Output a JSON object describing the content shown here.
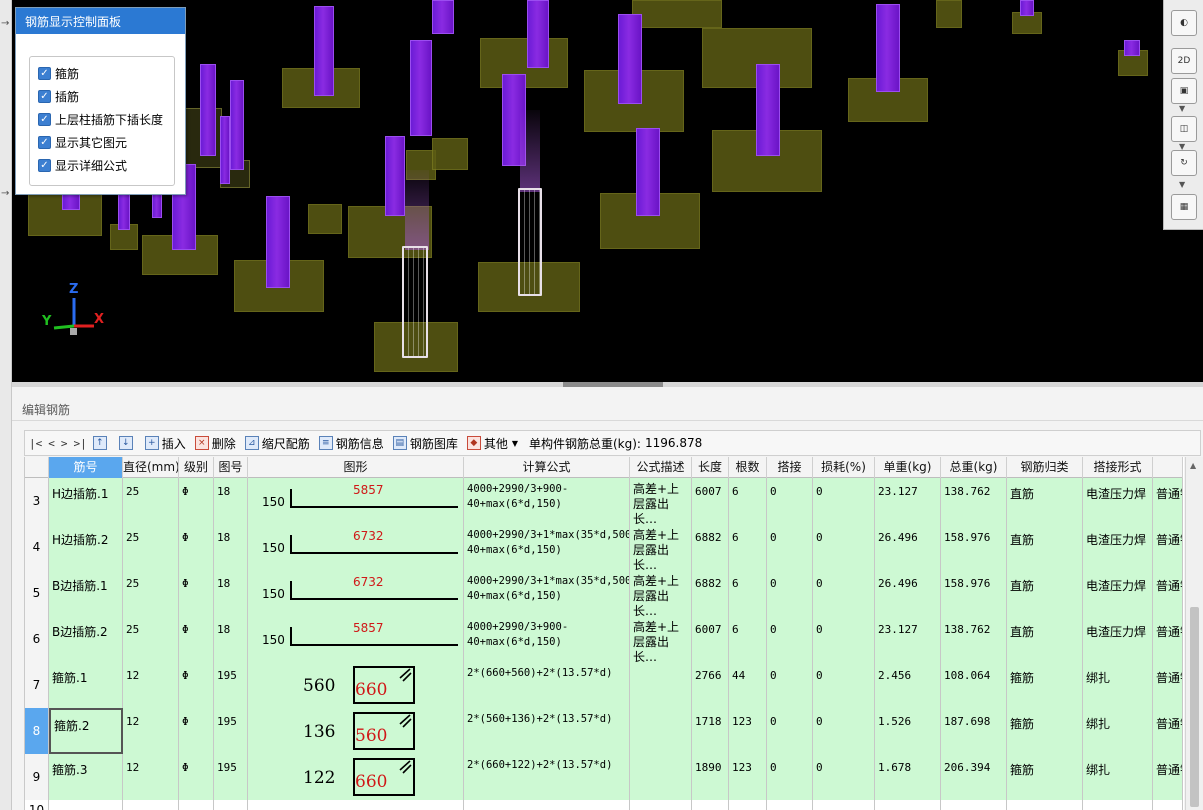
{
  "control_panel": {
    "title": "钢筋显示控制面板",
    "options": [
      {
        "label": "箍筋",
        "checked": true
      },
      {
        "label": "插筋",
        "checked": true
      },
      {
        "label": "上层柱插筋下插长度",
        "checked": true
      },
      {
        "label": "显示其它图元",
        "checked": true
      },
      {
        "label": "显示详细公式",
        "checked": true
      }
    ]
  },
  "axis": {
    "x": "X",
    "y": "Y",
    "z": "Z"
  },
  "view_tools": {
    "btn_2d": "2D"
  },
  "edit_panel": {
    "title": "编辑钢筋"
  },
  "toolbar": {
    "nav_first": "|<",
    "nav_prev": "<",
    "nav_next": ">",
    "nav_last": ">|",
    "insert": "插入",
    "delete": "删除",
    "scale_rebar": "缩尺配筋",
    "rebar_info": "钢筋信息",
    "rebar_library": "钢筋图库",
    "other": "其他",
    "total_weight_label": "单构件钢筋总重(kg):",
    "total_weight": "1196.878"
  },
  "table": {
    "headers": [
      "筋号",
      "直径(mm)",
      "级别",
      "图号",
      "图形",
      "计算公式",
      "公式描述",
      "长度",
      "根数",
      "搭接",
      "损耗(%)",
      "单重(kg)",
      "总重(kg)",
      "钢筋归类",
      "搭接形式",
      ""
    ],
    "rows": [
      {
        "num": "3",
        "name": "H边插筋.1",
        "dia": "25",
        "grade": "Φ",
        "fig": "18",
        "shape_type": "straight",
        "shape_left": "150",
        "shape_val": "5857",
        "formula": "4000+2990/3+900-40+max(6*d,150)",
        "desc": "高差+上层露出长…",
        "length": "6007",
        "count": "6",
        "lap": "0",
        "loss": "0",
        "unit_w": "23.127",
        "total_w": "138.762",
        "category": "直筋",
        "lap_type": "电渣压力焊",
        "extra": "普通钢筋"
      },
      {
        "num": "4",
        "name": "H边插筋.2",
        "dia": "25",
        "grade": "Φ",
        "fig": "18",
        "shape_type": "straight",
        "shape_left": "150",
        "shape_val": "6732",
        "formula": "4000+2990/3+1*max(35*d,500)+900-40+max(6*d,150)",
        "desc": "高差+上层露出长…",
        "length": "6882",
        "count": "6",
        "lap": "0",
        "loss": "0",
        "unit_w": "26.496",
        "total_w": "158.976",
        "category": "直筋",
        "lap_type": "电渣压力焊",
        "extra": "普通钢筋"
      },
      {
        "num": "5",
        "name": "B边插筋.1",
        "dia": "25",
        "grade": "Φ",
        "fig": "18",
        "shape_type": "straight",
        "shape_left": "150",
        "shape_val": "6732",
        "formula": "4000+2990/3+1*max(35*d,500)+900-40+max(6*d,150)",
        "desc": "高差+上层露出长…",
        "length": "6882",
        "count": "6",
        "lap": "0",
        "loss": "0",
        "unit_w": "26.496",
        "total_w": "158.976",
        "category": "直筋",
        "lap_type": "电渣压力焊",
        "extra": "普通钢筋"
      },
      {
        "num": "6",
        "name": "B边插筋.2",
        "dia": "25",
        "grade": "Φ",
        "fig": "18",
        "shape_type": "straight",
        "shape_left": "150",
        "shape_val": "5857",
        "formula": "4000+2990/3+900-40+max(6*d,150)",
        "desc": "高差+上层露出长…",
        "length": "6007",
        "count": "6",
        "lap": "0",
        "loss": "0",
        "unit_w": "23.127",
        "total_w": "138.762",
        "category": "直筋",
        "lap_type": "电渣压力焊",
        "extra": "普通钢筋"
      },
      {
        "num": "7",
        "name": "箍筋.1",
        "dia": "12",
        "grade": "Φ",
        "fig": "195",
        "shape_type": "stirrup",
        "shape_left": "560",
        "shape_val": "660",
        "formula": "2*(660+560)+2*(13.57*d)",
        "desc": "",
        "length": "2766",
        "count": "44",
        "lap": "0",
        "loss": "0",
        "unit_w": "2.456",
        "total_w": "108.064",
        "category": "箍筋",
        "lap_type": "绑扎",
        "extra": "普通钢筋"
      },
      {
        "num": "8",
        "name": "箍筋.2",
        "dia": "12",
        "grade": "Φ",
        "fig": "195",
        "shape_type": "stirrup",
        "shape_left": "136",
        "shape_val": "560",
        "formula": "2*(560+136)+2*(13.57*d)",
        "desc": "",
        "length": "1718",
        "count": "123",
        "lap": "0",
        "loss": "0",
        "unit_w": "1.526",
        "total_w": "187.698",
        "category": "箍筋",
        "lap_type": "绑扎",
        "extra": "普通钢筋",
        "selected": true
      },
      {
        "num": "9",
        "name": "箍筋.3",
        "dia": "12",
        "grade": "Φ",
        "fig": "195",
        "shape_type": "stirrup",
        "shape_left": "122",
        "shape_val": "660",
        "formula": "2*(660+122)+2*(13.57*d)",
        "desc": "",
        "length": "1890",
        "count": "123",
        "lap": "0",
        "loss": "0",
        "unit_w": "1.678",
        "total_w": "206.394",
        "category": "箍筋",
        "lap_type": "绑扎",
        "extra": "普通钢筋"
      }
    ],
    "next_row_num": "10"
  },
  "colors": {
    "panel_title": "#2b79d3",
    "row_bg": "#cdf9d3",
    "header_selected": "#5aa7ee",
    "column": "#8a2be2",
    "pad": "#5c5c14",
    "shape_value": "#d01818"
  }
}
